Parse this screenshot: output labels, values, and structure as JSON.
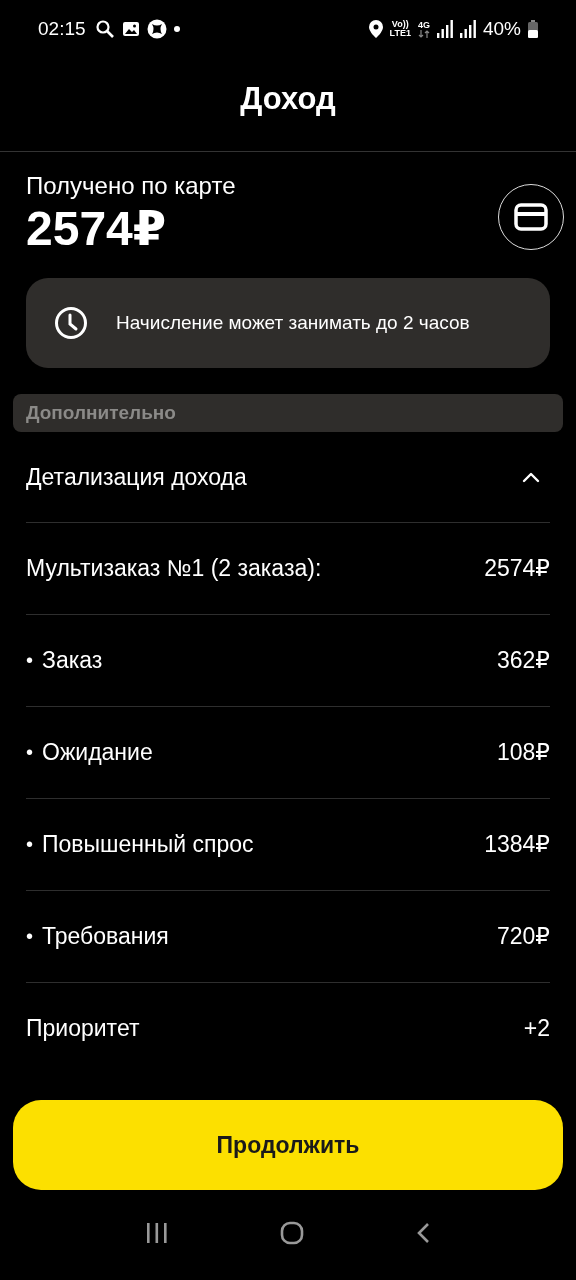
{
  "status_bar": {
    "time": "02:15",
    "volte": "Vo))",
    "lte": "LTE1",
    "network": "4G",
    "battery": "40%"
  },
  "header": {
    "title": "Доход"
  },
  "received": {
    "label": "Получено по карте",
    "amount": "2574₽"
  },
  "notice": {
    "text": "Начисление может занимать до 2 часов"
  },
  "section": {
    "title": "Дополнительно"
  },
  "details": {
    "title": "Детализация дохода",
    "expanded": true,
    "rows": [
      {
        "kind": "total",
        "label": "Мультизаказ №1 (2 заказа):",
        "value": "2574₽"
      },
      {
        "kind": "item",
        "bullet": "•",
        "label": "Заказ",
        "value": "362₽"
      },
      {
        "kind": "item",
        "bullet": "•",
        "label": "Ожидание",
        "value": "108₽"
      },
      {
        "kind": "item",
        "bullet": "•",
        "label": "Повышенный спрос",
        "value": "1384₽"
      },
      {
        "kind": "item",
        "bullet": "•",
        "label": "Требования",
        "value": "720₽"
      },
      {
        "kind": "total",
        "label": "Приоритет",
        "value": "+2"
      }
    ]
  },
  "continue_button": {
    "label": "Продолжить"
  }
}
